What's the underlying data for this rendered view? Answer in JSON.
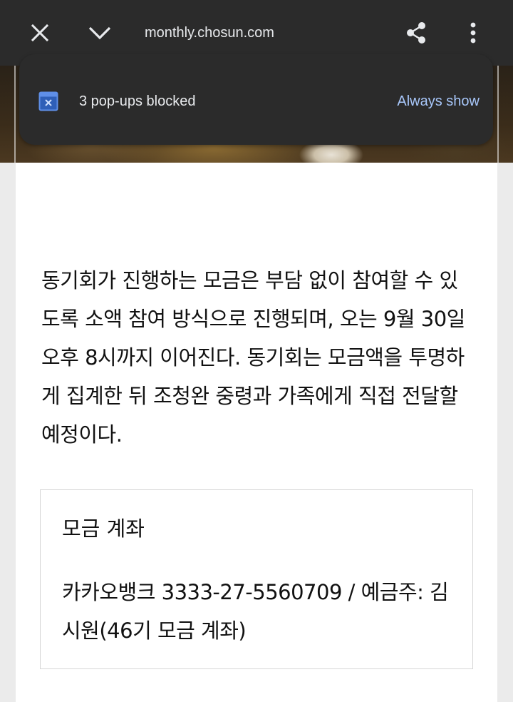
{
  "browser": {
    "url": "monthly.chosun.com",
    "icons": {
      "close": "close-icon",
      "collapse": "chevron-down-icon",
      "share": "share-icon",
      "menu": "more-vert-icon"
    }
  },
  "popup_notice": {
    "message": "3 pop-ups blocked",
    "action_label": "Always show",
    "icon": "popup-blocked-icon",
    "accent_color": "#a8c7fa"
  },
  "article": {
    "paragraph": "동기회가 진행하는 모금은 부담 없이 참여할 수 있도록 소액 참여 방식으로 진행되며, 오는 9월 30일 오후 8시까지 이어진다. 동기회는 모금액을 투명하게 집계한 뒤 조청완 중령과 가족에게 직접 전달할 예정이다.",
    "account_box": {
      "title": "모금 계좌",
      "detail": "카카오뱅크 3333-27-5560709 / 예금주: 김시원(46기 모금 계좌)"
    }
  }
}
